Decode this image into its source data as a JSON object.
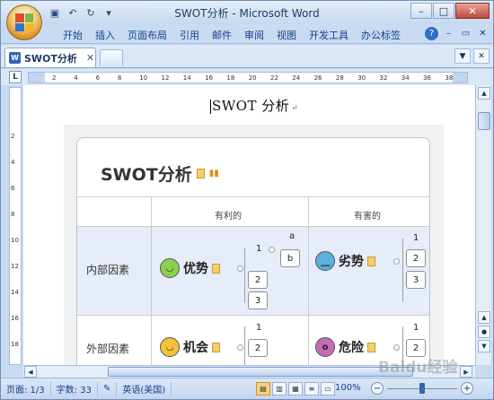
{
  "window": {
    "title": "SWOT分析 - Microsoft Word"
  },
  "ribbon": {
    "tabs": [
      "开始",
      "插入",
      "页面布局",
      "引用",
      "邮件",
      "审阅",
      "视图",
      "开发工具",
      "办公标签"
    ]
  },
  "doctabs": {
    "active": "SWOT分析"
  },
  "ruler": {
    "marks": [
      "2",
      "4",
      "6",
      "8",
      "10",
      "12",
      "14",
      "16",
      "18",
      "20",
      "22",
      "24",
      "26",
      "28",
      "30",
      "32",
      "34",
      "36",
      "38"
    ]
  },
  "vruler": {
    "marks": [
      "2",
      "4",
      "6",
      "8",
      "10",
      "12",
      "14",
      "16",
      "18"
    ]
  },
  "document": {
    "heading": "SWOT 分析"
  },
  "mindmap": {
    "title": "SWOT分析",
    "col_headers": [
      "有利的",
      "有害的"
    ],
    "row_labels": [
      "内部因素",
      "外部因素"
    ],
    "topics": {
      "strength": "优势",
      "weakness": "劣势",
      "opportunity": "机会",
      "threat": "危险"
    },
    "strength_subs": {
      "one": "1",
      "a": "a",
      "b": "b",
      "two": "2",
      "three": "3"
    },
    "weakness_subs": [
      "1",
      "2",
      "3"
    ],
    "opportunity_subs": [
      "1",
      "2"
    ],
    "threat_subs": [
      "1",
      "2"
    ]
  },
  "status": {
    "page": "页面: 1/3",
    "words": "字数: 33",
    "lang": "英语(美国)",
    "zoom": "100%"
  },
  "watermark": "Baidu经验"
}
